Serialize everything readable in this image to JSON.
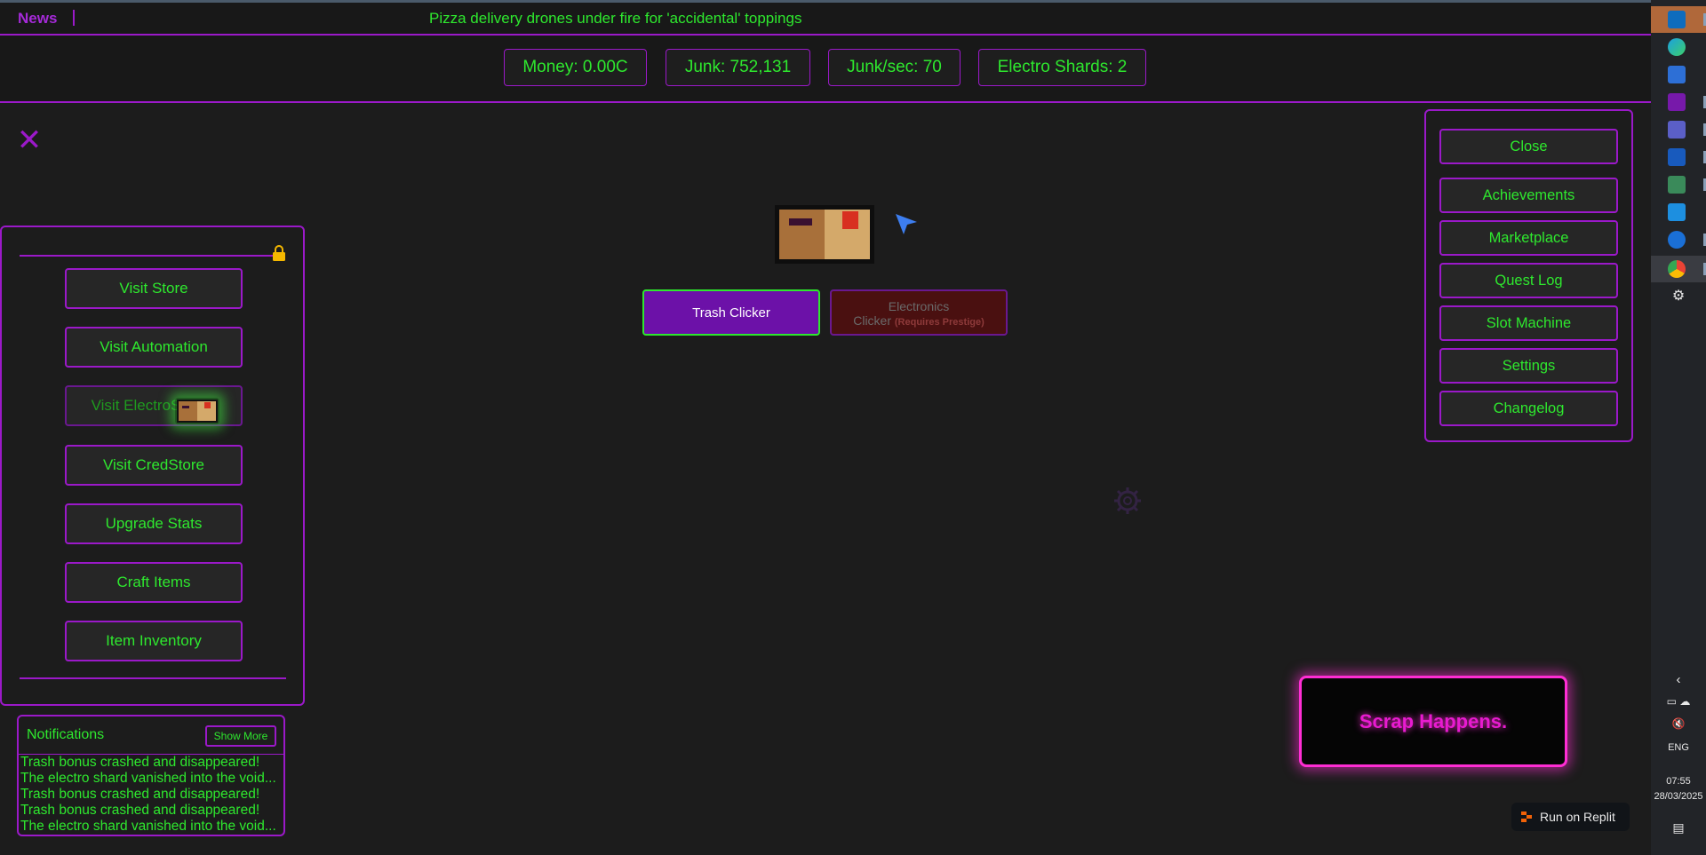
{
  "news": {
    "label": "News",
    "headline": "Pizza delivery drones under fire for 'accidental' toppings"
  },
  "stats": [
    {
      "label": "Money: 0.00C"
    },
    {
      "label": "Junk: 752,131"
    },
    {
      "label": "Junk/sec: 70"
    },
    {
      "label": "Electro Shards: 2"
    }
  ],
  "left_menu": {
    "items": [
      {
        "label": "Visit Store"
      },
      {
        "label": "Visit Automation"
      },
      {
        "label": "Visit ElectroS"
      },
      {
        "label": "Visit CredStore"
      },
      {
        "label": "Upgrade Stats"
      },
      {
        "label": "Craft Items"
      },
      {
        "label": "Item Inventory"
      }
    ]
  },
  "notifications": {
    "title": "Notifications",
    "show_more": "Show More",
    "items": [
      "Trash bonus crashed and disappeared!",
      "The electro shard vanished into the void...",
      "Trash bonus crashed and disappeared!",
      "Trash bonus crashed and disappeared!",
      "The electro shard vanished into the void..."
    ]
  },
  "clicker_tabs": {
    "trash": "Trash Clicker",
    "electronics_line1": "Electronics",
    "electronics_line2": "Clicker",
    "electronics_req": "(Requires Prestige)"
  },
  "right_menu": {
    "items": [
      {
        "label": "Close"
      },
      {
        "label": "Achievements"
      },
      {
        "label": "Marketplace"
      },
      {
        "label": "Quest Log"
      },
      {
        "label": "Slot Machine"
      },
      {
        "label": "Settings"
      },
      {
        "label": "Changelog"
      }
    ]
  },
  "scrap_banner": "Scrap Happens.",
  "replit": "Run on Replit",
  "taskbar": {
    "lang": "ENG",
    "time": "07:55",
    "date": "28/03/2025"
  },
  "colors": {
    "accent": "#9b19c9",
    "text": "#2ee82e",
    "bg": "#1c1c1c",
    "scrap": "#ff2dd4"
  }
}
